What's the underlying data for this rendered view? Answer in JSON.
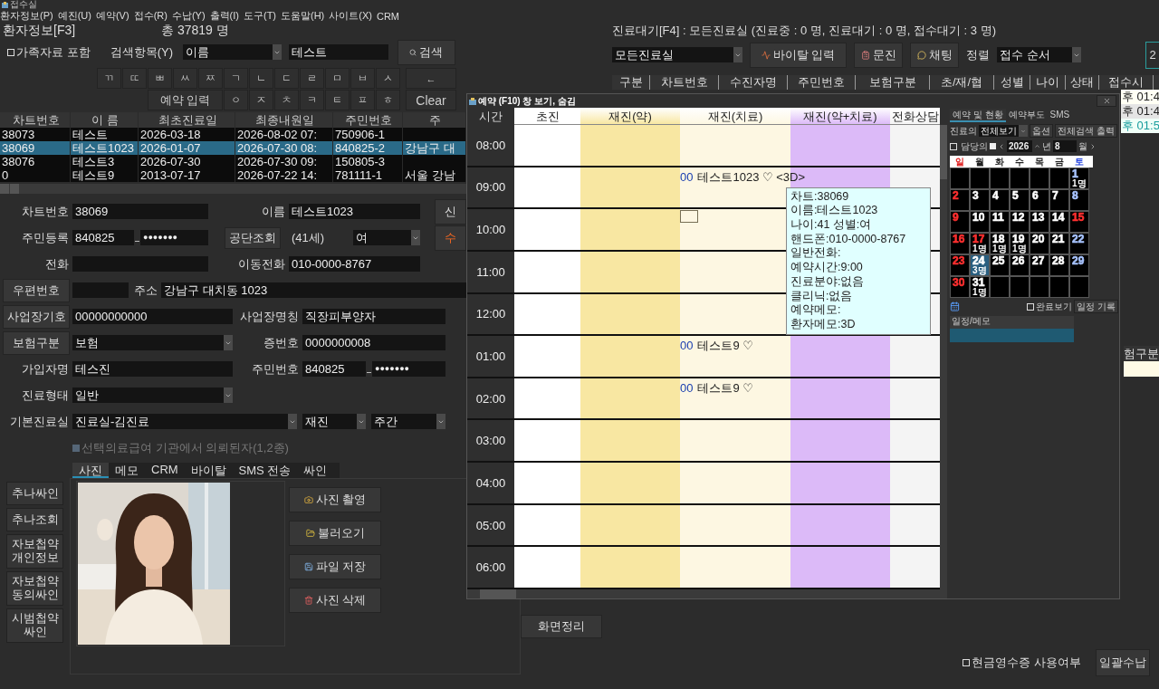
{
  "app_title": "접수실",
  "menu": [
    "환자정보(P)",
    "예진(U)",
    "예약(V)",
    "접수(R)",
    "수납(Y)",
    "출력(I)",
    "도구(T)",
    "도움말(H)",
    "사이트(X)",
    "CRM"
  ],
  "patient": {
    "title": "환자정보[F3]",
    "total": "총 37819 명",
    "family_checkbox": {
      "label": "가족자료 포함",
      "checked": false
    },
    "search_label": "검색항목(Y)",
    "search_field": "이름",
    "search_value": "테스트",
    "search_button": "검색",
    "keypad": {
      "row1": [
        "ㄲ",
        "ㄸ",
        "ㅃ",
        "ㅆ",
        "ㅉ",
        "ㄱ",
        "ㄴ",
        "ㄷ",
        "ㄹ",
        "ㅁ",
        "ㅂ",
        "ㅅ"
      ],
      "back": "←",
      "reserve": "예약 입력",
      "row2": [
        "ㅇ",
        "ㅈ",
        "ㅊ",
        "ㅋ",
        "ㅌ",
        "ㅍ",
        "ㅎ"
      ],
      "clear": "Clear"
    },
    "table": {
      "columns": [
        "차트번호",
        "이 름",
        "최초진료일",
        "최종내원일",
        "주민번호",
        "주"
      ],
      "rows": [
        {
          "chart": "38073",
          "name": "테스트",
          "first_visit": "2026-03-18",
          "last_visit": "2026-08-02 07:",
          "rrn": "750906-1",
          "selected": false
        },
        {
          "chart": "38069",
          "name": "테스트1023",
          "first_visit": "2026-01-07",
          "last_visit": "2026-07-30 08:",
          "rrn": "840825-2",
          "address": "강남구 대",
          "selected": true
        },
        {
          "chart": "38076",
          "name": "테스트3",
          "first_visit": "2026-07-30",
          "last_visit": "2026-07-30 09:",
          "rrn": "150805-3",
          "selected": false
        },
        {
          "chart": "0",
          "name": "테스트9",
          "first_visit": "2013-07-17",
          "last_visit": "2026-07-22 14:",
          "rrn": "781111-1",
          "address": "서울 강남",
          "selected": false
        }
      ]
    }
  },
  "form": {
    "chart_no": {
      "label": "차트번호",
      "value": "38069"
    },
    "name": {
      "label": "이름",
      "value": "테스트1023"
    },
    "new_button": "신",
    "rrn": {
      "label": "주민등록",
      "front": "840825",
      "back": "●●●●●●●"
    },
    "nhis_button": "공단조회",
    "age": "(41세)",
    "sex": "여",
    "edit_button": "수",
    "phone": {
      "label": "전화"
    },
    "mobile": {
      "label": "이동전화",
      "value": "010-0000-8767"
    },
    "zip_button": "우편번호",
    "address": {
      "label": "주소",
      "value": "강남구 대치동 1023"
    },
    "workplace_code_button": "사업장기호",
    "workplace_code": "00000000000",
    "workplace_name": {
      "label": "사업장명칭",
      "value": "직장피부양자"
    },
    "insurance_button": "보험구분",
    "insurance": "보험",
    "card_no": {
      "label": "증번호",
      "value": "0000000008"
    },
    "subscriber": {
      "label": "가입자명",
      "value": "테스진"
    },
    "subscriber_rrn": {
      "label": "주민번호",
      "front": "840825",
      "back": "●●●●●●●"
    },
    "care_type": {
      "label": "진료형태",
      "value": "일반"
    },
    "room": {
      "label": "기본진료실",
      "value": "진료실-김진료",
      "visit": "재진",
      "shift": "주간"
    },
    "medical_aid": {
      "label": "선택의료급여 기관에서 의뢰된자(1,2종)",
      "checked": true,
      "disabled": true
    }
  },
  "tabs": [
    {
      "label": "사진",
      "selected": true
    },
    {
      "label": "메모",
      "selected": false
    },
    {
      "label": "CRM",
      "selected": false
    },
    {
      "label": "바이탈",
      "selected": false
    },
    {
      "label": "SMS 전송",
      "selected": false
    },
    {
      "label": "싸인",
      "selected": false
    }
  ],
  "side_buttons": [
    "추나싸인",
    "추나조회",
    "자보첩약 개인정보",
    "자보첩약 동의싸인",
    "시범첩약 싸인"
  ],
  "photo": {
    "kind": "picture"
  },
  "photo_buttons": [
    {
      "label": "사진 촬영",
      "kind": "camera"
    },
    {
      "label": "불러오기",
      "kind": "open"
    },
    {
      "label": "파일 저장",
      "kind": "save"
    },
    {
      "label": "사진 삭제",
      "kind": "delete"
    }
  ],
  "tidy_button": "화면정리",
  "waiting": {
    "title": "진료대기[F4] : 모든진료실 (진료중 : 0 명, 진료대기 : 0 명, 접수대기 : 3 명)",
    "room": "모든진료실",
    "buttons": [
      {
        "label": "바이탈 입력",
        "kind": "vital"
      },
      {
        "label": "문진",
        "kind": "interview"
      },
      {
        "label": "채팅",
        "kind": "chat"
      }
    ],
    "sort_label": "정렬",
    "sort": "접수 순서",
    "page": "2",
    "columns": [
      "구분",
      "차트번호",
      "수진자명",
      "주민번호",
      "보험구분",
      "초/재/협",
      "성별",
      "나이",
      "상태",
      "접수시"
    ],
    "rows": [
      {
        "time": "후 01:4",
        "selected": false
      },
      {
        "time": "후 01:4",
        "selected": false
      },
      {
        "time": "후 01:5",
        "selected": true
      }
    ]
  },
  "payment": {
    "column": "험구분"
  },
  "cash_receipt": {
    "label": "현금영수증 사용여부",
    "checked": false
  },
  "bulk_pay_button": "일괄수납",
  "reservation": {
    "title": "예약 (F10) 창 보기, 숨김",
    "time_header": "시간",
    "columns": [
      {
        "label": "초진",
        "kind": "new",
        "color": "#ffffff"
      },
      {
        "label": "재진(약)",
        "kind": "med",
        "color": "#f8e7a2"
      },
      {
        "label": "재진(치료)",
        "kind": "treat",
        "color": "#fdf7e2"
      },
      {
        "label": "재진(약+치료)",
        "kind": "both",
        "color": "#dcbaf8"
      },
      {
        "label": "전화상담",
        "kind": "phone",
        "color": "#f4f4f4"
      }
    ],
    "slots": [
      {
        "time": "08:00",
        "selected": false
      },
      {
        "time": "09:00",
        "selected": false,
        "entries": [
          {
            "kind": "treat",
            "mark": "00",
            "text": "테스트1023 ♡ <3D>",
            "tooltip": [
              "차트:38069",
              "이름:테스트1023",
              "나이:41 성별:여",
              "핸드폰:010-0000-8767",
              "일반전화:",
              "예약시간:9:00",
              "진료분야:없음",
              "클리닉:없음",
              "예약메모:",
              "환자메모:3D"
            ]
          }
        ]
      },
      {
        "time": "10:00",
        "selected": true
      },
      {
        "time": "11:00",
        "selected": false
      },
      {
        "time": "12:00",
        "selected": false
      },
      {
        "time": "01:00",
        "selected": false,
        "entries": [
          {
            "kind": "treat",
            "mark": "00",
            "text": "테스트9 ♡"
          }
        ]
      },
      {
        "time": "02:00",
        "selected": false,
        "entries": [
          {
            "kind": "treat",
            "mark": "00",
            "text": "테스트9 ♡"
          }
        ]
      },
      {
        "time": "03:00",
        "selected": false
      },
      {
        "time": "04:00",
        "selected": false
      },
      {
        "time": "05:00",
        "selected": false
      },
      {
        "time": "06:00",
        "selected": false
      }
    ]
  },
  "calendar": {
    "tabs": [
      {
        "label": "예약 및 현황",
        "selected": true
      },
      {
        "label": "예약부도",
        "selected": false
      },
      {
        "label": "SMS",
        "selected": false
      }
    ],
    "doctor_label": "진료의",
    "doctor": "전체보기",
    "option_button": "옵션",
    "print_button": "전체검색 출력",
    "mine_checkbox": {
      "label": "담당의",
      "checked": false
    },
    "year": "2026",
    "year_unit": "년",
    "month": "8",
    "month_unit": "월",
    "weekdays": [
      {
        "label": "일",
        "color": "#e02020"
      },
      {
        "label": "월",
        "color": "#222222"
      },
      {
        "label": "화",
        "color": "#222222"
      },
      {
        "label": "수",
        "color": "#222222"
      },
      {
        "label": "목",
        "color": "#222222"
      },
      {
        "label": "금",
        "color": "#222222"
      },
      {
        "label": "토",
        "color": "#2040e0"
      }
    ],
    "weeks": [
      [
        {
          "day": "1",
          "count": "1명",
          "color": "#a8c4ff",
          "selected": false
        }
      ],
      [
        {
          "day": "2",
          "color": "#ff3030",
          "selected": false
        },
        {
          "day": "3",
          "color": "#ffffff",
          "selected": false
        },
        {
          "day": "4",
          "color": "#ffffff",
          "selected": false
        },
        {
          "day": "5",
          "color": "#ffffff",
          "selected": false
        },
        {
          "day": "6",
          "color": "#ffffff",
          "selected": false
        },
        {
          "day": "7",
          "color": "#ffffff",
          "selected": false
        },
        {
          "day": "8",
          "color": "#a8c4ff",
          "selected": false
        }
      ],
      [
        {
          "day": "9",
          "color": "#ff3030",
          "selected": false
        },
        {
          "day": "10",
          "color": "#ffffff",
          "selected": false
        },
        {
          "day": "11",
          "color": "#ffffff",
          "selected": false
        },
        {
          "day": "12",
          "color": "#ffffff",
          "selected": false
        },
        {
          "day": "13",
          "color": "#ffffff",
          "selected": false
        },
        {
          "day": "14",
          "color": "#ffffff",
          "selected": false
        },
        {
          "day": "15",
          "color": "#ff3030",
          "selected": false
        }
      ],
      [
        {
          "day": "16",
          "color": "#ff3030",
          "selected": false
        },
        {
          "day": "17",
          "count": "1명",
          "color": "#ff3030",
          "selected": false
        },
        {
          "day": "18",
          "count": "1명",
          "color": "#ffffff",
          "selected": false
        },
        {
          "day": "19",
          "count": "1명",
          "color": "#ffffff",
          "selected": false
        },
        {
          "day": "20",
          "color": "#ffffff",
          "selected": false
        },
        {
          "day": "21",
          "color": "#ffffff",
          "selected": false
        },
        {
          "day": "22",
          "color": "#a8c4ff",
          "selected": false
        }
      ],
      [
        {
          "day": "23",
          "color": "#ff3030",
          "selected": false
        },
        {
          "day": "24",
          "count": "3명",
          "color": "#ffffff",
          "selected": true
        },
        {
          "day": "25",
          "color": "#ffffff",
          "selected": false
        },
        {
          "day": "26",
          "color": "#ffffff",
          "selected": false
        },
        {
          "day": "27",
          "color": "#ffffff",
          "selected": false
        },
        {
          "day": "28",
          "color": "#ffffff",
          "selected": false
        },
        {
          "day": "29",
          "color": "#a8c4ff",
          "selected": false
        }
      ],
      [
        {
          "day": "30",
          "color": "#ff3030",
          "selected": false
        },
        {
          "day": "31",
          "count": "1명",
          "color": "#ffffff",
          "selected": false
        }
      ]
    ],
    "done_checkbox": {
      "label": "완료보기",
      "checked": false
    },
    "record_button": "일정 기록",
    "memo_header": "일정/메모"
  }
}
